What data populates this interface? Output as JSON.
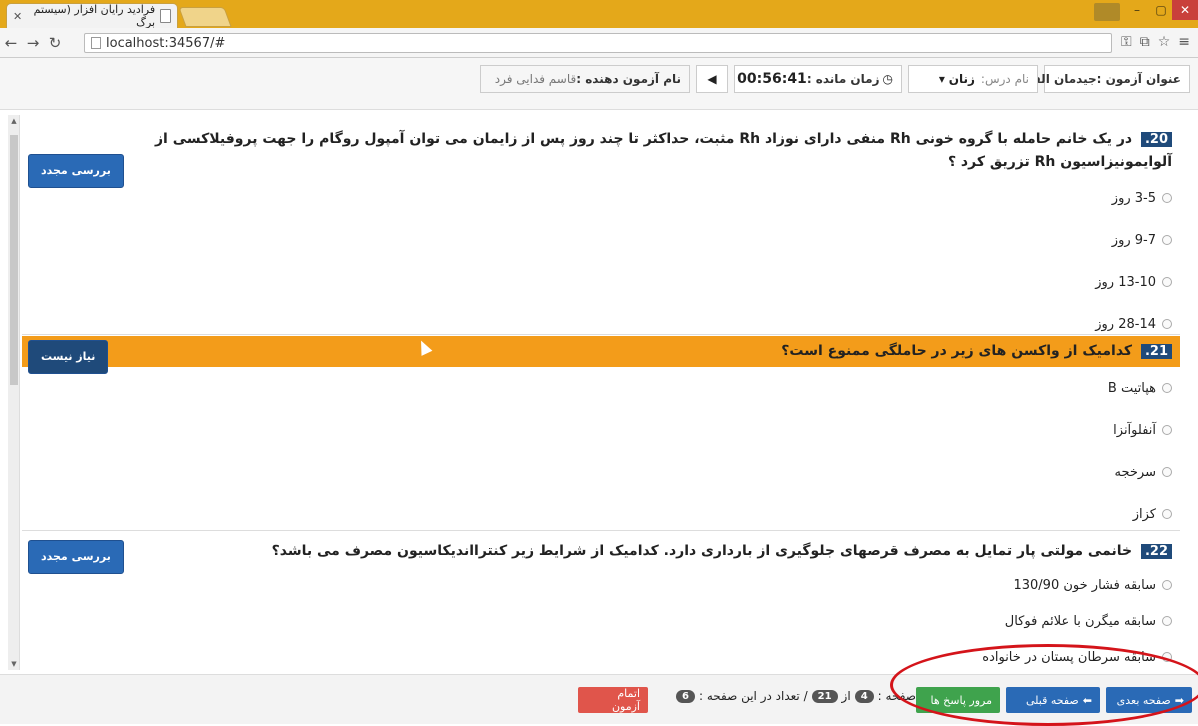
{
  "browser": {
    "tab_title": "فرادید رایان افزار (سیستم برگ",
    "url": "localhost:34567/#"
  },
  "exam_bar": {
    "exam_title_label": "عنوان آزمون :",
    "exam_title_value": "جیدمان الف",
    "course_label": "نام درس:",
    "course_value": "زنان",
    "time_left_label": "زمان مانده :",
    "timer": "00:56:41",
    "examinee_label": "نام آزمون دهنده :",
    "examinee_value": "قاسم فدایی فرد"
  },
  "questions": [
    {
      "number": "20.",
      "text": "در یک خانم حامله با گروه خونی Rh منفی دارای نوزاد Rh مثبت، حداکثر تا چند روز پس از زایمان می توان آمپول روگام را جهت پروفیلاکسی از آلوایمونیزاسیون Rh تزریق کرد ؟",
      "button": "بررسی مجدد",
      "options": [
        "3-5 روز",
        "9-7 روز",
        "13-10 روز",
        "28-14 روز"
      ]
    },
    {
      "number": "21.",
      "text": "کدامیک از واکسن های زیر در حاملگی ممنوع است؟",
      "button": "نیاز نیست",
      "options": [
        "هپاتیت B",
        "آنفلوآنزا",
        "سرخجه",
        "کزاز"
      ]
    },
    {
      "number": "22.",
      "text": "خانمی مولتی پار تمایل به مصرف قرصهای جلوگیری از بارداری دارد. کدامیک از شرایط زیر کنترااندیکاسیون مصرف می باشد؟",
      "button": "بررسی مجدد",
      "options": [
        "سابقه فشار خون 130/90",
        "سابقه میگرن با علائم فوکال",
        "سابقه سرطان پستان در خانواده"
      ]
    }
  ],
  "footer": {
    "next_page": "صفحه بعدی",
    "prev_page": "صفحه قبلی",
    "review_answers": "مرور پاسخ ها",
    "page_label": "صفحه :",
    "page_current": "4",
    "of_label": "از",
    "page_total": "21",
    "count_label": "/ تعداد در این صفحه :",
    "count_value": "6",
    "finish_exam": "اتمام آزمون"
  },
  "colors": {
    "primary_button": "#2a6ab6",
    "success_button": "#3fa34d",
    "danger_button": "#e0554b",
    "highlight_row": "#f39c1a",
    "annotation_circle": "#d4141a"
  }
}
